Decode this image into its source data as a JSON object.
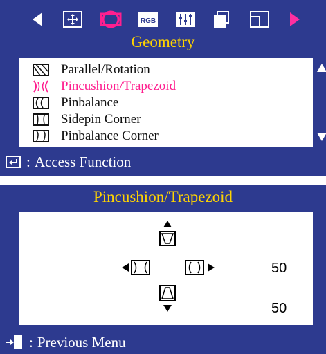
{
  "top_panel": {
    "icons": [
      "position-icon",
      "geometry-icon",
      "rgb-icon",
      "color-bars-icon",
      "multi-window-icon",
      "window-icon"
    ],
    "rgb_text": "RGB",
    "title": "Geometry",
    "menu_items": [
      {
        "label": "Parallel/Rotation",
        "icon": "parallel-icon",
        "selected": false
      },
      {
        "label": "Pincushion/Trapezoid",
        "icon": "pincushion-icon",
        "selected": true
      },
      {
        "label": "Pinbalance",
        "icon": "pinbalance-icon",
        "selected": false
      },
      {
        "label": "Sidepin Corner",
        "icon": "sidepin-icon",
        "selected": false
      },
      {
        "label": "Pinbalance Corner",
        "icon": "pinbalance-corner-icon",
        "selected": false
      }
    ],
    "footer": {
      "separator": ":",
      "label": "Access Function",
      "icon": "enter-icon"
    }
  },
  "bottom_panel": {
    "title": "Pincushion/Trapezoid",
    "pincushion_value": "50",
    "trapezoid_value": "50",
    "footer": {
      "separator": ":",
      "label": "Previous Menu",
      "icon": "exit-icon"
    }
  },
  "colors": {
    "panel_bg": "#2d3a8f",
    "title": "#ffd400",
    "selected": "#ff1f8f",
    "text": "#111111"
  }
}
